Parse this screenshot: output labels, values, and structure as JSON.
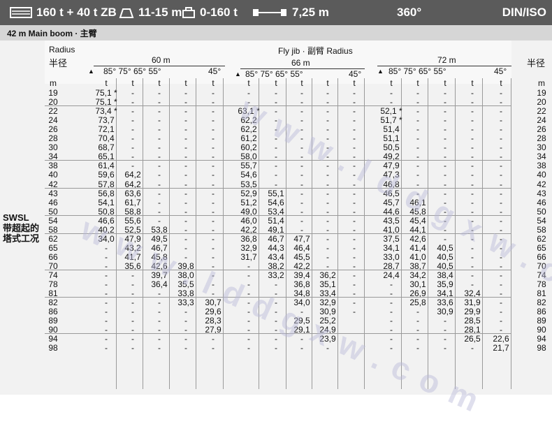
{
  "topbar": {
    "capacity": "160 t + 40 t ZB",
    "counterweight_range": "11-15 m",
    "load_range": "0-160 t",
    "width": "7,25 m",
    "slew": "360°",
    "standard": "DIN/ISO"
  },
  "subbar": {
    "boom_label": "42 m  Main boom · 主臂"
  },
  "headers": {
    "radius_en": "Radius",
    "radius_zh": "半径",
    "fly_jib_title": "Fly jib · 副臂 Radius",
    "right_radius_zh": "半径",
    "group1_length": "60 m",
    "group2_length": "66 m",
    "group3_length": "72 m",
    "angles_main": "85° 75° 65° 55°",
    "angle_45": "45°",
    "unit_m": "m",
    "unit_t": "t"
  },
  "side_label": [
    "SWSL",
    "带超起的",
    "塔式工况"
  ],
  "watermark": "www.lddgxw.com",
  "rows": [
    {
      "r": "19",
      "g1": [
        "75,1 *",
        "-",
        "-",
        "-",
        "-"
      ],
      "g2": [
        "-",
        "-",
        "-",
        "-",
        "-"
      ],
      "g3": [
        "-",
        "-",
        "-",
        "-",
        "-"
      ]
    },
    {
      "r": "20",
      "g1": [
        "75,1 *",
        "-",
        "-",
        "-",
        "-"
      ],
      "g2": [
        "-",
        "-",
        "-",
        "-",
        "-"
      ],
      "g3": [
        "-",
        "-",
        "-",
        "-",
        "-"
      ]
    },
    {
      "r": "22",
      "g1": [
        "73,4 *",
        "-",
        "-",
        "-",
        "-"
      ],
      "g2": [
        "63,1 *",
        "-",
        "-",
        "-",
        "-"
      ],
      "g3": [
        "52,1 *",
        "-",
        "-",
        "-",
        "-"
      ]
    },
    {
      "r": "24",
      "g1": [
        "73,7",
        "-",
        "-",
        "-",
        "-"
      ],
      "g2": [
        "62,2",
        "-",
        "-",
        "-",
        "-"
      ],
      "g3": [
        "51,7 *",
        "-",
        "-",
        "-",
        "-"
      ]
    },
    {
      "r": "26",
      "g1": [
        "72,1",
        "-",
        "-",
        "-",
        "-"
      ],
      "g2": [
        "62,2",
        "-",
        "-",
        "-",
        "-"
      ],
      "g3": [
        "51,4",
        "-",
        "-",
        "-",
        "-"
      ]
    },
    {
      "r": "28",
      "g1": [
        "70,4",
        "-",
        "-",
        "-",
        "-"
      ],
      "g2": [
        "61,2",
        "-",
        "-",
        "-",
        "-"
      ],
      "g3": [
        "51,1",
        "-",
        "-",
        "-",
        "-"
      ]
    },
    {
      "r": "30",
      "g1": [
        "68,7",
        "-",
        "-",
        "-",
        "-"
      ],
      "g2": [
        "60,2",
        "-",
        "-",
        "-",
        "-"
      ],
      "g3": [
        "50,5",
        "-",
        "-",
        "-",
        "-"
      ]
    },
    {
      "r": "34",
      "g1": [
        "65,1",
        "-",
        "-",
        "-",
        "-"
      ],
      "g2": [
        "58,0",
        "-",
        "-",
        "-",
        "-"
      ],
      "g3": [
        "49,2",
        "-",
        "-",
        "-",
        "-"
      ]
    },
    {
      "r": "38",
      "g1": [
        "61,4",
        "-",
        "-",
        "-",
        "-"
      ],
      "g2": [
        "55,7",
        "-",
        "-",
        "-",
        "-"
      ],
      "g3": [
        "47,9",
        "-",
        "-",
        "-",
        "-"
      ]
    },
    {
      "r": "40",
      "g1": [
        "59,6",
        "64,2",
        "-",
        "-",
        "-"
      ],
      "g2": [
        "54,6",
        "-",
        "-",
        "-",
        "-"
      ],
      "g3": [
        "47,3",
        "-",
        "-",
        "-",
        "-"
      ]
    },
    {
      "r": "42",
      "g1": [
        "57,8",
        "64,2",
        "-",
        "-",
        "-"
      ],
      "g2": [
        "53,5",
        "-",
        "-",
        "-",
        "-"
      ],
      "g3": [
        "46,8",
        "-",
        "-",
        "-",
        "-"
      ]
    },
    {
      "r": "43",
      "g1": [
        "56,8",
        "63,6",
        "-",
        "-",
        "-"
      ],
      "g2": [
        "52,9",
        "55,1",
        "-",
        "-",
        "-"
      ],
      "g3": [
        "46,5",
        "-",
        "-",
        "-",
        "-"
      ]
    },
    {
      "r": "46",
      "g1": [
        "54,1",
        "61,7",
        "-",
        "-",
        "-"
      ],
      "g2": [
        "51,2",
        "54,6",
        "-",
        "-",
        "-"
      ],
      "g3": [
        "45,7",
        "46,1",
        "-",
        "-",
        "-"
      ]
    },
    {
      "r": "50",
      "g1": [
        "50,8",
        "58,8",
        "-",
        "-",
        "-"
      ],
      "g2": [
        "49,0",
        "53,4",
        "-",
        "-",
        "-"
      ],
      "g3": [
        "44,6",
        "45,8",
        "-",
        "-",
        "-"
      ]
    },
    {
      "r": "54",
      "g1": [
        "46,6",
        "55,6",
        "-",
        "-",
        "-"
      ],
      "g2": [
        "46,0",
        "51,4",
        "-",
        "-",
        "-"
      ],
      "g3": [
        "43,5",
        "45,4",
        "-",
        "-",
        "-"
      ]
    },
    {
      "r": "58",
      "g1": [
        "40,2",
        "52,5",
        "53,8",
        "-",
        "-"
      ],
      "g2": [
        "42,2",
        "49,1",
        "-",
        "-",
        "-"
      ],
      "g3": [
        "41,0",
        "44,1",
        "-",
        "-",
        "-"
      ]
    },
    {
      "r": "62",
      "g1": [
        "34,0",
        "47,9",
        "49,5",
        "-",
        "-"
      ],
      "g2": [
        "36,8",
        "46,7",
        "47,7",
        "-",
        "-"
      ],
      "g3": [
        "37,5",
        "42,6",
        "-",
        "-",
        "-"
      ]
    },
    {
      "r": "65",
      "g1": [
        "-",
        "43,2",
        "46,7",
        "-",
        "-"
      ],
      "g2": [
        "32,9",
        "44,3",
        "46,4",
        "-",
        "-"
      ],
      "g3": [
        "34,1",
        "41,4",
        "40,5",
        "-",
        "-"
      ]
    },
    {
      "r": "66",
      "g1": [
        "-",
        "41,7",
        "45,8",
        "-",
        "-"
      ],
      "g2": [
        "31,7",
        "43,4",
        "45,5",
        "-",
        "-"
      ],
      "g3": [
        "33,0",
        "41,0",
        "40,5",
        "-",
        "-"
      ]
    },
    {
      "r": "70",
      "g1": [
        "-",
        "35,6",
        "42,6",
        "39,8",
        "-"
      ],
      "g2": [
        "-",
        "38,2",
        "42,2",
        "-",
        "-"
      ],
      "g3": [
        "28,7",
        "38,7",
        "40,5",
        "-",
        "-"
      ]
    },
    {
      "r": "74",
      "g1": [
        "-",
        "-",
        "39,7",
        "38,0",
        "-"
      ],
      "g2": [
        "-",
        "33,2",
        "39,4",
        "36,2",
        "-"
      ],
      "g3": [
        "24,4",
        "34,2",
        "38,4",
        "-",
        "-"
      ]
    },
    {
      "r": "78",
      "g1": [
        "-",
        "-",
        "36,4",
        "35,5",
        "-"
      ],
      "g2": [
        "-",
        "-",
        "36,8",
        "35,1",
        "-"
      ],
      "g3": [
        "-",
        "30,1",
        "35,9",
        "-",
        "-"
      ]
    },
    {
      "r": "81",
      "g1": [
        "-",
        "-",
        "-",
        "33,8",
        "-"
      ],
      "g2": [
        "-",
        "-",
        "34,8",
        "33,4",
        "-"
      ],
      "g3": [
        "-",
        "26,9",
        "34,1",
        "32,4",
        "-"
      ]
    },
    {
      "r": "82",
      "g1": [
        "-",
        "-",
        "-",
        "33,3",
        "30,7"
      ],
      "g2": [
        "-",
        "-",
        "34,0",
        "32,9",
        "-"
      ],
      "g3": [
        "-",
        "25,8",
        "33,6",
        "31,9",
        "-"
      ]
    },
    {
      "r": "86",
      "g1": [
        "-",
        "-",
        "-",
        "-",
        "29,6"
      ],
      "g2": [
        "-",
        "-",
        "-",
        "30,9",
        "-"
      ],
      "g3": [
        "-",
        "-",
        "30,9",
        "29,9",
        "-"
      ]
    },
    {
      "r": "89",
      "g1": [
        "-",
        "-",
        "-",
        "-",
        "28,3"
      ],
      "g2": [
        "-",
        "-",
        "29,5",
        "25,2"
      ],
      "g3": [
        "-",
        "-",
        "-",
        "28,5",
        "-"
      ]
    },
    {
      "r": "90",
      "g1": [
        "-",
        "-",
        "-",
        "-",
        "27,9"
      ],
      "g2": [
        "-",
        "-",
        "29,1",
        "24,9"
      ],
      "g3": [
        "-",
        "-",
        "-",
        "28,1",
        "-"
      ]
    },
    {
      "r": "94",
      "g1": [
        "-",
        "-",
        "-",
        "-",
        "-"
      ],
      "g2": [
        "-",
        "-",
        "-",
        "23,9"
      ],
      "g3": [
        "-",
        "-",
        "-",
        "26,5",
        "22,6"
      ]
    },
    {
      "r": "98",
      "g1": [
        "-",
        "-",
        "-",
        "-",
        "-"
      ],
      "g2": [
        "-",
        "-",
        "-",
        "-"
      ],
      "g3": [
        "-",
        "-",
        "-",
        "-",
        "21,7"
      ]
    }
  ]
}
